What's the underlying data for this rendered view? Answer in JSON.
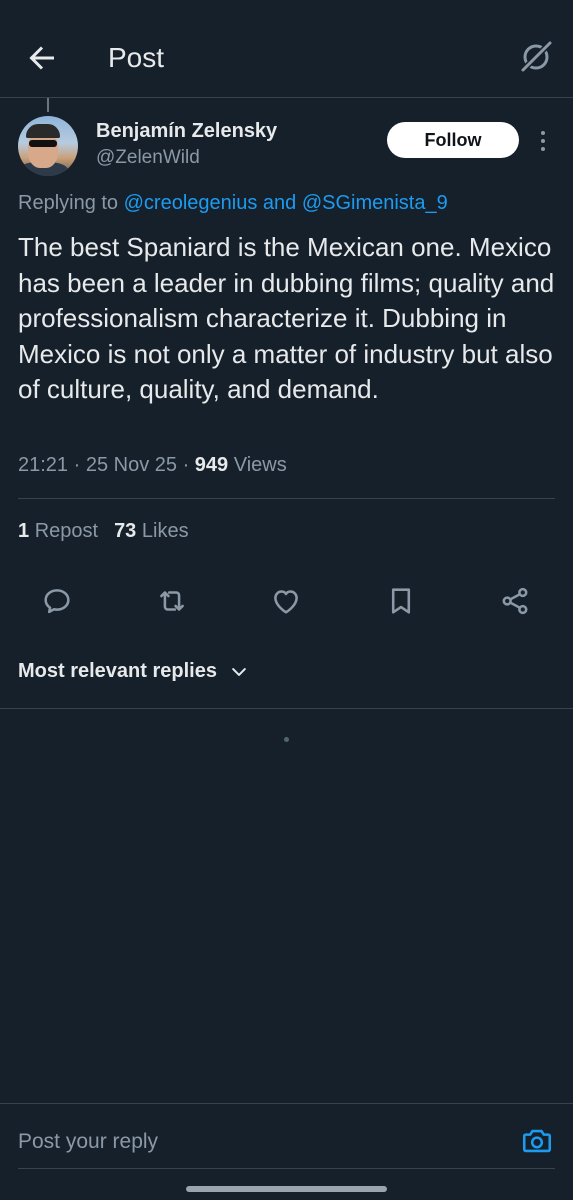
{
  "header": {
    "title": "Post",
    "back_icon": "arrow-left-icon",
    "grok_icon": "grok-icon"
  },
  "author": {
    "name": "Benjamín Zelensky",
    "handle": "@ZelenWild",
    "follow_label": "Follow"
  },
  "replying": {
    "prefix": "Replying to",
    "mentions": "@creolegenius and @SGimenista_9"
  },
  "post": {
    "text": "The best Spaniard is the Mexican one. Mexico has been a leader in dubbing films; quality and professionalism characterize it. Dubbing in Mexico is not only a matter of industry but also of culture, quality, and demand.",
    "time": "21:21",
    "date": "25 Nov 25",
    "views_count": "949",
    "views_label": "Views"
  },
  "stats": {
    "reposts_count": "1",
    "reposts_label": "Repost",
    "likes_count": "73",
    "likes_label": "Likes"
  },
  "actions": [
    {
      "name": "reply",
      "icon": "comment-icon"
    },
    {
      "name": "repost",
      "icon": "repost-icon"
    },
    {
      "name": "like",
      "icon": "heart-icon"
    },
    {
      "name": "bookmark",
      "icon": "bookmark-icon"
    },
    {
      "name": "share",
      "icon": "share-icon"
    }
  ],
  "replies_sort": {
    "label": "Most relevant replies"
  },
  "composer": {
    "placeholder": "Post your reply"
  },
  "colors": {
    "background": "#15202b",
    "accent": "#1d9bf0",
    "text_primary": "#e7e9ea",
    "text_secondary": "#8b98a5",
    "divider": "#38444d"
  }
}
